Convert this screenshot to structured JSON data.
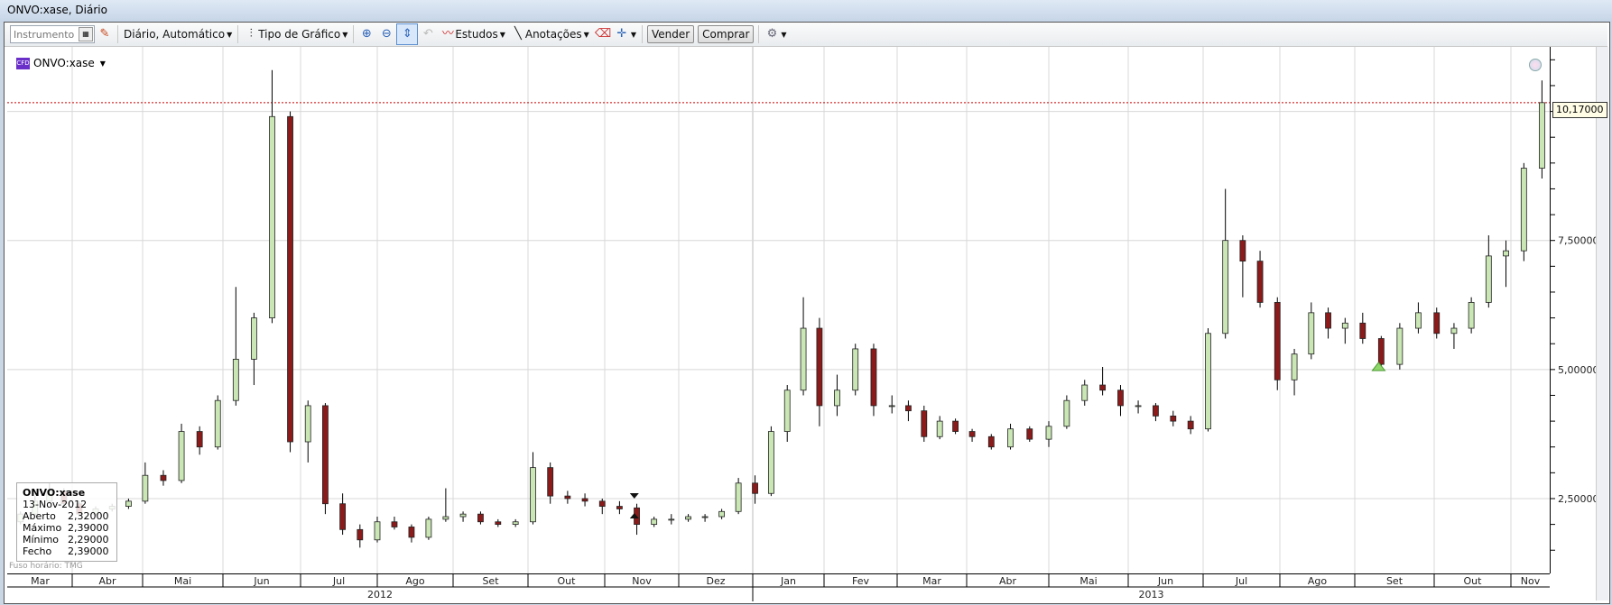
{
  "window": {
    "title": "ONVO:xase, Diário"
  },
  "toolbar": {
    "instrument_placeholder": "Instrumento",
    "period_label": "Diário,  Automático",
    "chart_type_label": "Tipo de Gráfico",
    "studies_label": "Estudos",
    "annotations_label": "Anotações",
    "sell_label": "Vender",
    "buy_label": "Comprar"
  },
  "legend": {
    "badge": "CFD",
    "symbol": "ONVO:xase"
  },
  "tooltip": {
    "symbol": "ONVO:xase",
    "date": "13-Nov-2012",
    "rows": [
      {
        "label": "Aberto",
        "value": "2,32000"
      },
      {
        "label": "Máximo",
        "value": "2,39000"
      },
      {
        "label": "Mínimo",
        "value": "2,29000"
      },
      {
        "label": "Fecho",
        "value": "2,39000"
      }
    ]
  },
  "timezone_label": "Fuso horário: TMG",
  "current_price_label": "10,17000",
  "colors": {
    "up": "#c9e6b4",
    "down": "#8b1a1a",
    "price_line": "#cc0000",
    "grid": "#d8d8d8"
  },
  "chart_data": {
    "type": "candlestick",
    "ylim": [
      1.05,
      11.25
    ],
    "y_ticks": [
      2.5,
      5.0,
      7.5
    ],
    "y_tick_labels": [
      "2,50000",
      "5,00000",
      "7,50000"
    ],
    "current_price": 10.17,
    "grid": true,
    "months": [
      {
        "label": "Mar",
        "start": "2012-03-01"
      },
      {
        "label": "Abr",
        "start": "2012-04-01"
      },
      {
        "label": "Mai",
        "start": "2012-05-01"
      },
      {
        "label": "Jun",
        "start": "2012-06-01"
      },
      {
        "label": "Jul",
        "start": "2012-07-01"
      },
      {
        "label": "Ago",
        "start": "2012-08-01"
      },
      {
        "label": "Set",
        "start": "2012-09-01"
      },
      {
        "label": "Out",
        "start": "2012-10-01"
      },
      {
        "label": "Nov",
        "start": "2012-11-01"
      },
      {
        "label": "Dez",
        "start": "2012-12-01"
      },
      {
        "label": "Jan",
        "start": "2013-01-01"
      },
      {
        "label": "Fev",
        "start": "2013-02-01"
      },
      {
        "label": "Mar",
        "start": "2013-03-01"
      },
      {
        "label": "Abr",
        "start": "2013-04-01"
      },
      {
        "label": "Mai",
        "start": "2013-05-01"
      },
      {
        "label": "Jun",
        "start": "2013-06-01"
      },
      {
        "label": "Jul",
        "start": "2013-07-01"
      },
      {
        "label": "Ago",
        "start": "2013-08-01"
      },
      {
        "label": "Set",
        "start": "2013-09-01"
      },
      {
        "label": "Out",
        "start": "2013-10-01"
      },
      {
        "label": "Nov",
        "start": "2013-11-01"
      }
    ],
    "years": [
      {
        "label": "2012"
      },
      {
        "label": "2013"
      }
    ],
    "candles": [
      {
        "d": "2012-03-05",
        "o": 2.05,
        "h": 2.25,
        "l": 2.0,
        "c": 2.2
      },
      {
        "d": "2012-03-12",
        "o": 2.2,
        "h": 2.55,
        "l": 2.15,
        "c": 2.45
      },
      {
        "d": "2012-03-19",
        "o": 2.45,
        "h": 2.8,
        "l": 2.4,
        "c": 2.65
      },
      {
        "d": "2012-03-26",
        "o": 2.65,
        "h": 2.7,
        "l": 2.35,
        "c": 2.4
      },
      {
        "d": "2012-04-02",
        "o": 2.4,
        "h": 2.45,
        "l": 2.15,
        "c": 2.2
      },
      {
        "d": "2012-04-09",
        "o": 2.2,
        "h": 2.35,
        "l": 2.15,
        "c": 2.3
      },
      {
        "d": "2012-04-16",
        "o": 2.3,
        "h": 2.4,
        "l": 2.25,
        "c": 2.35
      },
      {
        "d": "2012-04-23",
        "o": 2.35,
        "h": 2.5,
        "l": 2.3,
        "c": 2.45
      },
      {
        "d": "2012-04-30",
        "o": 2.45,
        "h": 3.2,
        "l": 2.4,
        "c": 2.95
      },
      {
        "d": "2012-05-07",
        "o": 2.95,
        "h": 3.05,
        "l": 2.75,
        "c": 2.85
      },
      {
        "d": "2012-05-14",
        "o": 2.85,
        "h": 3.95,
        "l": 2.8,
        "c": 3.8
      },
      {
        "d": "2012-05-21",
        "o": 3.8,
        "h": 3.9,
        "l": 3.35,
        "c": 3.5
      },
      {
        "d": "2012-05-28",
        "o": 3.5,
        "h": 4.5,
        "l": 3.45,
        "c": 4.4
      },
      {
        "d": "2012-06-04",
        "o": 4.4,
        "h": 6.6,
        "l": 4.3,
        "c": 5.2
      },
      {
        "d": "2012-06-11",
        "o": 5.2,
        "h": 6.1,
        "l": 4.7,
        "c": 6.0
      },
      {
        "d": "2012-06-18",
        "o": 6.0,
        "h": 10.8,
        "l": 5.9,
        "c": 9.9
      },
      {
        "d": "2012-06-25",
        "o": 9.9,
        "h": 10.0,
        "l": 3.4,
        "c": 3.6
      },
      {
        "d": "2012-07-02",
        "o": 3.6,
        "h": 4.4,
        "l": 3.2,
        "c": 4.3
      },
      {
        "d": "2012-07-09",
        "o": 4.3,
        "h": 4.35,
        "l": 2.2,
        "c": 2.4
      },
      {
        "d": "2012-07-16",
        "o": 2.4,
        "h": 2.6,
        "l": 1.8,
        "c": 1.9
      },
      {
        "d": "2012-07-23",
        "o": 1.9,
        "h": 2.0,
        "l": 1.55,
        "c": 1.7
      },
      {
        "d": "2012-07-30",
        "o": 1.7,
        "h": 2.15,
        "l": 1.65,
        "c": 2.05
      },
      {
        "d": "2012-08-06",
        "o": 2.05,
        "h": 2.15,
        "l": 1.9,
        "c": 1.95
      },
      {
        "d": "2012-08-13",
        "o": 1.95,
        "h": 2.0,
        "l": 1.65,
        "c": 1.75
      },
      {
        "d": "2012-08-20",
        "o": 1.75,
        "h": 2.15,
        "l": 1.7,
        "c": 2.1
      },
      {
        "d": "2012-08-27",
        "o": 2.1,
        "h": 2.7,
        "l": 2.05,
        "c": 2.15
      },
      {
        "d": "2012-09-03",
        "o": 2.15,
        "h": 2.25,
        "l": 2.05,
        "c": 2.2
      },
      {
        "d": "2012-09-10",
        "o": 2.2,
        "h": 2.25,
        "l": 2.0,
        "c": 2.05
      },
      {
        "d": "2012-09-17",
        "o": 2.05,
        "h": 2.1,
        "l": 1.95,
        "c": 2.0
      },
      {
        "d": "2012-09-24",
        "o": 2.0,
        "h": 2.1,
        "l": 1.95,
        "c": 2.05
      },
      {
        "d": "2012-10-01",
        "o": 2.05,
        "h": 3.4,
        "l": 2.0,
        "c": 3.1
      },
      {
        "d": "2012-10-08",
        "o": 3.1,
        "h": 3.2,
        "l": 2.4,
        "c": 2.55
      },
      {
        "d": "2012-10-15",
        "o": 2.55,
        "h": 2.65,
        "l": 2.4,
        "c": 2.5
      },
      {
        "d": "2012-10-22",
        "o": 2.5,
        "h": 2.6,
        "l": 2.35,
        "c": 2.45
      },
      {
        "d": "2012-10-29",
        "o": 2.45,
        "h": 2.5,
        "l": 2.2,
        "c": 2.35
      },
      {
        "d": "2012-11-05",
        "o": 2.35,
        "h": 2.45,
        "l": 2.2,
        "c": 2.3
      },
      {
        "d": "2012-11-12",
        "o": 2.32,
        "h": 2.4,
        "l": 1.8,
        "c": 2.0
      },
      {
        "d": "2012-11-19",
        "o": 2.0,
        "h": 2.15,
        "l": 1.95,
        "c": 2.1
      },
      {
        "d": "2012-11-26",
        "o": 2.1,
        "h": 2.2,
        "l": 2.0,
        "c": 2.1
      },
      {
        "d": "2012-12-03",
        "o": 2.1,
        "h": 2.2,
        "l": 2.05,
        "c": 2.15
      },
      {
        "d": "2012-12-10",
        "o": 2.15,
        "h": 2.2,
        "l": 2.05,
        "c": 2.15
      },
      {
        "d": "2012-12-17",
        "o": 2.15,
        "h": 2.3,
        "l": 2.1,
        "c": 2.25
      },
      {
        "d": "2012-12-24",
        "o": 2.25,
        "h": 2.9,
        "l": 2.2,
        "c": 2.8
      },
      {
        "d": "2012-12-31",
        "o": 2.8,
        "h": 2.95,
        "l": 2.4,
        "c": 2.6
      },
      {
        "d": "2013-01-07",
        "o": 2.6,
        "h": 3.9,
        "l": 2.55,
        "c": 3.8
      },
      {
        "d": "2013-01-14",
        "o": 3.8,
        "h": 4.7,
        "l": 3.6,
        "c": 4.6
      },
      {
        "d": "2013-01-21",
        "o": 4.6,
        "h": 6.4,
        "l": 4.5,
        "c": 5.8
      },
      {
        "d": "2013-01-28",
        "o": 5.8,
        "h": 6.0,
        "l": 3.9,
        "c": 4.3
      },
      {
        "d": "2013-02-04",
        "o": 4.3,
        "h": 4.9,
        "l": 4.1,
        "c": 4.6
      },
      {
        "d": "2013-02-11",
        "o": 4.6,
        "h": 5.5,
        "l": 4.5,
        "c": 5.4
      },
      {
        "d": "2013-02-18",
        "o": 5.4,
        "h": 5.5,
        "l": 4.1,
        "c": 4.3
      },
      {
        "d": "2013-02-25",
        "o": 4.3,
        "h": 4.5,
        "l": 4.15,
        "c": 4.3
      },
      {
        "d": "2013-03-04",
        "o": 4.3,
        "h": 4.4,
        "l": 4.0,
        "c": 4.2
      },
      {
        "d": "2013-03-11",
        "o": 4.2,
        "h": 4.3,
        "l": 3.6,
        "c": 3.7
      },
      {
        "d": "2013-03-18",
        "o": 3.7,
        "h": 4.1,
        "l": 3.65,
        "c": 4.0
      },
      {
        "d": "2013-03-25",
        "o": 4.0,
        "h": 4.05,
        "l": 3.75,
        "c": 3.8
      },
      {
        "d": "2013-04-01",
        "o": 3.8,
        "h": 3.85,
        "l": 3.6,
        "c": 3.7
      },
      {
        "d": "2013-04-08",
        "o": 3.7,
        "h": 3.75,
        "l": 3.45,
        "c": 3.5
      },
      {
        "d": "2013-04-15",
        "o": 3.5,
        "h": 3.95,
        "l": 3.45,
        "c": 3.85
      },
      {
        "d": "2013-04-22",
        "o": 3.85,
        "h": 3.9,
        "l": 3.6,
        "c": 3.65
      },
      {
        "d": "2013-04-29",
        "o": 3.65,
        "h": 4.0,
        "l": 3.5,
        "c": 3.9
      },
      {
        "d": "2013-05-06",
        "o": 3.9,
        "h": 4.5,
        "l": 3.85,
        "c": 4.4
      },
      {
        "d": "2013-05-13",
        "o": 4.4,
        "h": 4.8,
        "l": 4.3,
        "c": 4.7
      },
      {
        "d": "2013-05-20",
        "o": 4.7,
        "h": 5.05,
        "l": 4.5,
        "c": 4.6
      },
      {
        "d": "2013-05-27",
        "o": 4.6,
        "h": 4.7,
        "l": 4.1,
        "c": 4.3
      },
      {
        "d": "2013-06-03",
        "o": 4.3,
        "h": 4.4,
        "l": 4.15,
        "c": 4.3
      },
      {
        "d": "2013-06-10",
        "o": 4.3,
        "h": 4.35,
        "l": 4.0,
        "c": 4.1
      },
      {
        "d": "2013-06-17",
        "o": 4.1,
        "h": 4.2,
        "l": 3.9,
        "c": 4.0
      },
      {
        "d": "2013-06-24",
        "o": 4.0,
        "h": 4.1,
        "l": 3.75,
        "c": 3.85
      },
      {
        "d": "2013-07-01",
        "o": 3.85,
        "h": 5.8,
        "l": 3.8,
        "c": 5.7
      },
      {
        "d": "2013-07-08",
        "o": 5.7,
        "h": 8.5,
        "l": 5.6,
        "c": 7.5
      },
      {
        "d": "2013-07-15",
        "o": 7.5,
        "h": 7.6,
        "l": 6.4,
        "c": 7.1
      },
      {
        "d": "2013-07-22",
        "o": 7.1,
        "h": 7.3,
        "l": 6.2,
        "c": 6.3
      },
      {
        "d": "2013-07-29",
        "o": 6.3,
        "h": 6.4,
        "l": 4.6,
        "c": 4.8
      },
      {
        "d": "2013-08-05",
        "o": 4.8,
        "h": 5.4,
        "l": 4.5,
        "c": 5.3
      },
      {
        "d": "2013-08-12",
        "o": 5.3,
        "h": 6.3,
        "l": 5.2,
        "c": 6.1
      },
      {
        "d": "2013-08-19",
        "o": 6.1,
        "h": 6.2,
        "l": 5.6,
        "c": 5.8
      },
      {
        "d": "2013-08-26",
        "o": 5.8,
        "h": 6.0,
        "l": 5.5,
        "c": 5.9
      },
      {
        "d": "2013-09-02",
        "o": 5.9,
        "h": 6.1,
        "l": 5.5,
        "c": 5.6
      },
      {
        "d": "2013-09-09",
        "o": 5.6,
        "h": 5.65,
        "l": 5.0,
        "c": 5.1
      },
      {
        "d": "2013-09-16",
        "o": 5.1,
        "h": 5.9,
        "l": 5.0,
        "c": 5.8
      },
      {
        "d": "2013-09-23",
        "o": 5.8,
        "h": 6.3,
        "l": 5.7,
        "c": 6.1
      },
      {
        "d": "2013-09-30",
        "o": 6.1,
        "h": 6.2,
        "l": 5.6,
        "c": 5.7
      },
      {
        "d": "2013-10-07",
        "o": 5.7,
        "h": 5.9,
        "l": 5.4,
        "c": 5.8
      },
      {
        "d": "2013-10-14",
        "o": 5.8,
        "h": 6.4,
        "l": 5.7,
        "c": 6.3
      },
      {
        "d": "2013-10-21",
        "o": 6.3,
        "h": 7.6,
        "l": 6.2,
        "c": 7.2
      },
      {
        "d": "2013-10-28",
        "o": 7.2,
        "h": 7.5,
        "l": 6.6,
        "c": 7.3
      },
      {
        "d": "2013-11-04",
        "o": 7.3,
        "h": 9.0,
        "l": 7.1,
        "c": 8.9
      },
      {
        "d": "2013-11-11",
        "o": 8.9,
        "h": 10.6,
        "l": 8.7,
        "c": 10.17
      }
    ],
    "markers": [
      {
        "type": "selected-bar",
        "d": "2012-11-13",
        "price": 2.36
      },
      {
        "type": "alert-triangle",
        "d": "2013-09-10",
        "price": 5.05
      }
    ]
  }
}
